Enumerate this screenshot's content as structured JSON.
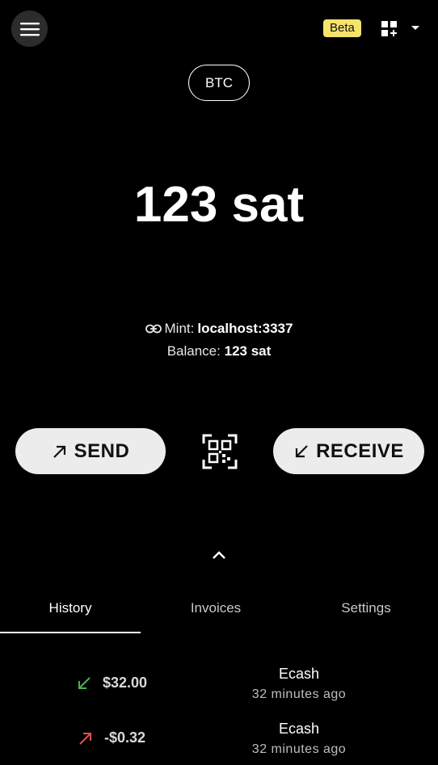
{
  "header": {
    "beta_badge": "Beta",
    "accent_color": "#f6e36b"
  },
  "unit": {
    "label": "BTC"
  },
  "balance": {
    "display": "123 sat"
  },
  "mint": {
    "prefix": "Mint:",
    "url": "localhost:3337",
    "balance_prefix": "Balance:",
    "balance_value": "123 sat"
  },
  "actions": {
    "send_label": "SEND",
    "receive_label": "RECEIVE"
  },
  "tabs": [
    {
      "label": "History",
      "active": true
    },
    {
      "label": "Invoices",
      "active": false
    },
    {
      "label": "Settings",
      "active": false
    }
  ],
  "transactions": [
    {
      "amount": "$32.00",
      "direction": "incoming",
      "type": "Ecash",
      "time": "32 minutes ago",
      "color": "#4caf50"
    },
    {
      "amount": "-$0.32",
      "direction": "outgoing",
      "type": "Ecash",
      "time": "32 minutes ago",
      "color": "#e05050"
    }
  ]
}
